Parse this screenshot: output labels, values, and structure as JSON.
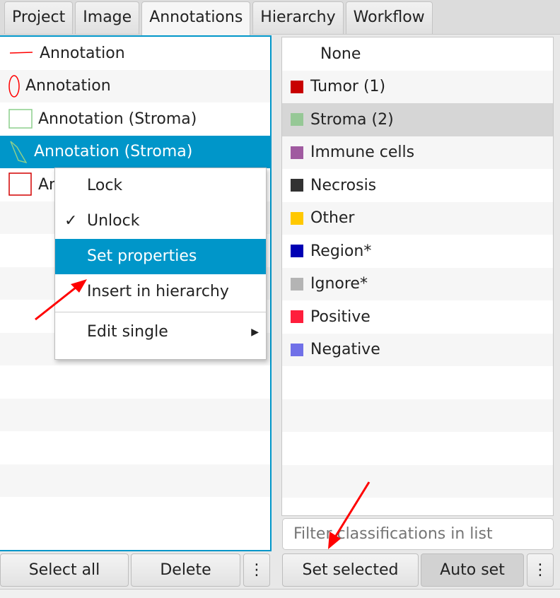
{
  "tabs": [
    "Project",
    "Image",
    "Annotations",
    "Hierarchy",
    "Workflow"
  ],
  "active_tab": "Annotations",
  "annotations": [
    {
      "label": "Annotation",
      "shape": "line",
      "color": "#ff0000"
    },
    {
      "label": "Annotation",
      "shape": "ellipse",
      "color": "#ff0000"
    },
    {
      "label": "Annotation (Stroma)",
      "shape": "rectangle",
      "color": "#8ccf8c"
    },
    {
      "label": "Annotation (Stroma)",
      "shape": "polygon",
      "color": "#8ccf8c",
      "selected": true
    },
    {
      "label": "Annotation",
      "shape": "rectangle",
      "color": "#d40000"
    }
  ],
  "left_buttons": {
    "select_all": "Select all",
    "delete": "Delete",
    "more": "⋮"
  },
  "context_menu": {
    "lock": "Lock",
    "unlock": "Unlock",
    "unlock_check": "✓",
    "set_properties": "Set properties",
    "insert": "Insert in hierarchy",
    "edit_single": "Edit single",
    "submenu_arrow": "▶"
  },
  "classes": [
    {
      "label": "None",
      "color": null
    },
    {
      "label": "Tumor (1)",
      "color": "#c80000"
    },
    {
      "label": "Stroma (2)",
      "color": "#96c896",
      "highlighted": true
    },
    {
      "label": "Immune cells",
      "color": "#a05aa0"
    },
    {
      "label": "Necrosis",
      "color": "#323232"
    },
    {
      "label": "Other",
      "color": "#ffc800"
    },
    {
      "label": "Region*",
      "color": "#0000b4"
    },
    {
      "label": "Ignore*",
      "color": "#b4b4b4"
    },
    {
      "label": "Positive",
      "color": "#ff1e3c"
    },
    {
      "label": "Negative",
      "color": "#7070e8"
    }
  ],
  "filter_placeholder": "Filter classifications in list",
  "right_buttons": {
    "set_selected": "Set selected",
    "auto_set": "Auto set",
    "more": "⋮"
  }
}
